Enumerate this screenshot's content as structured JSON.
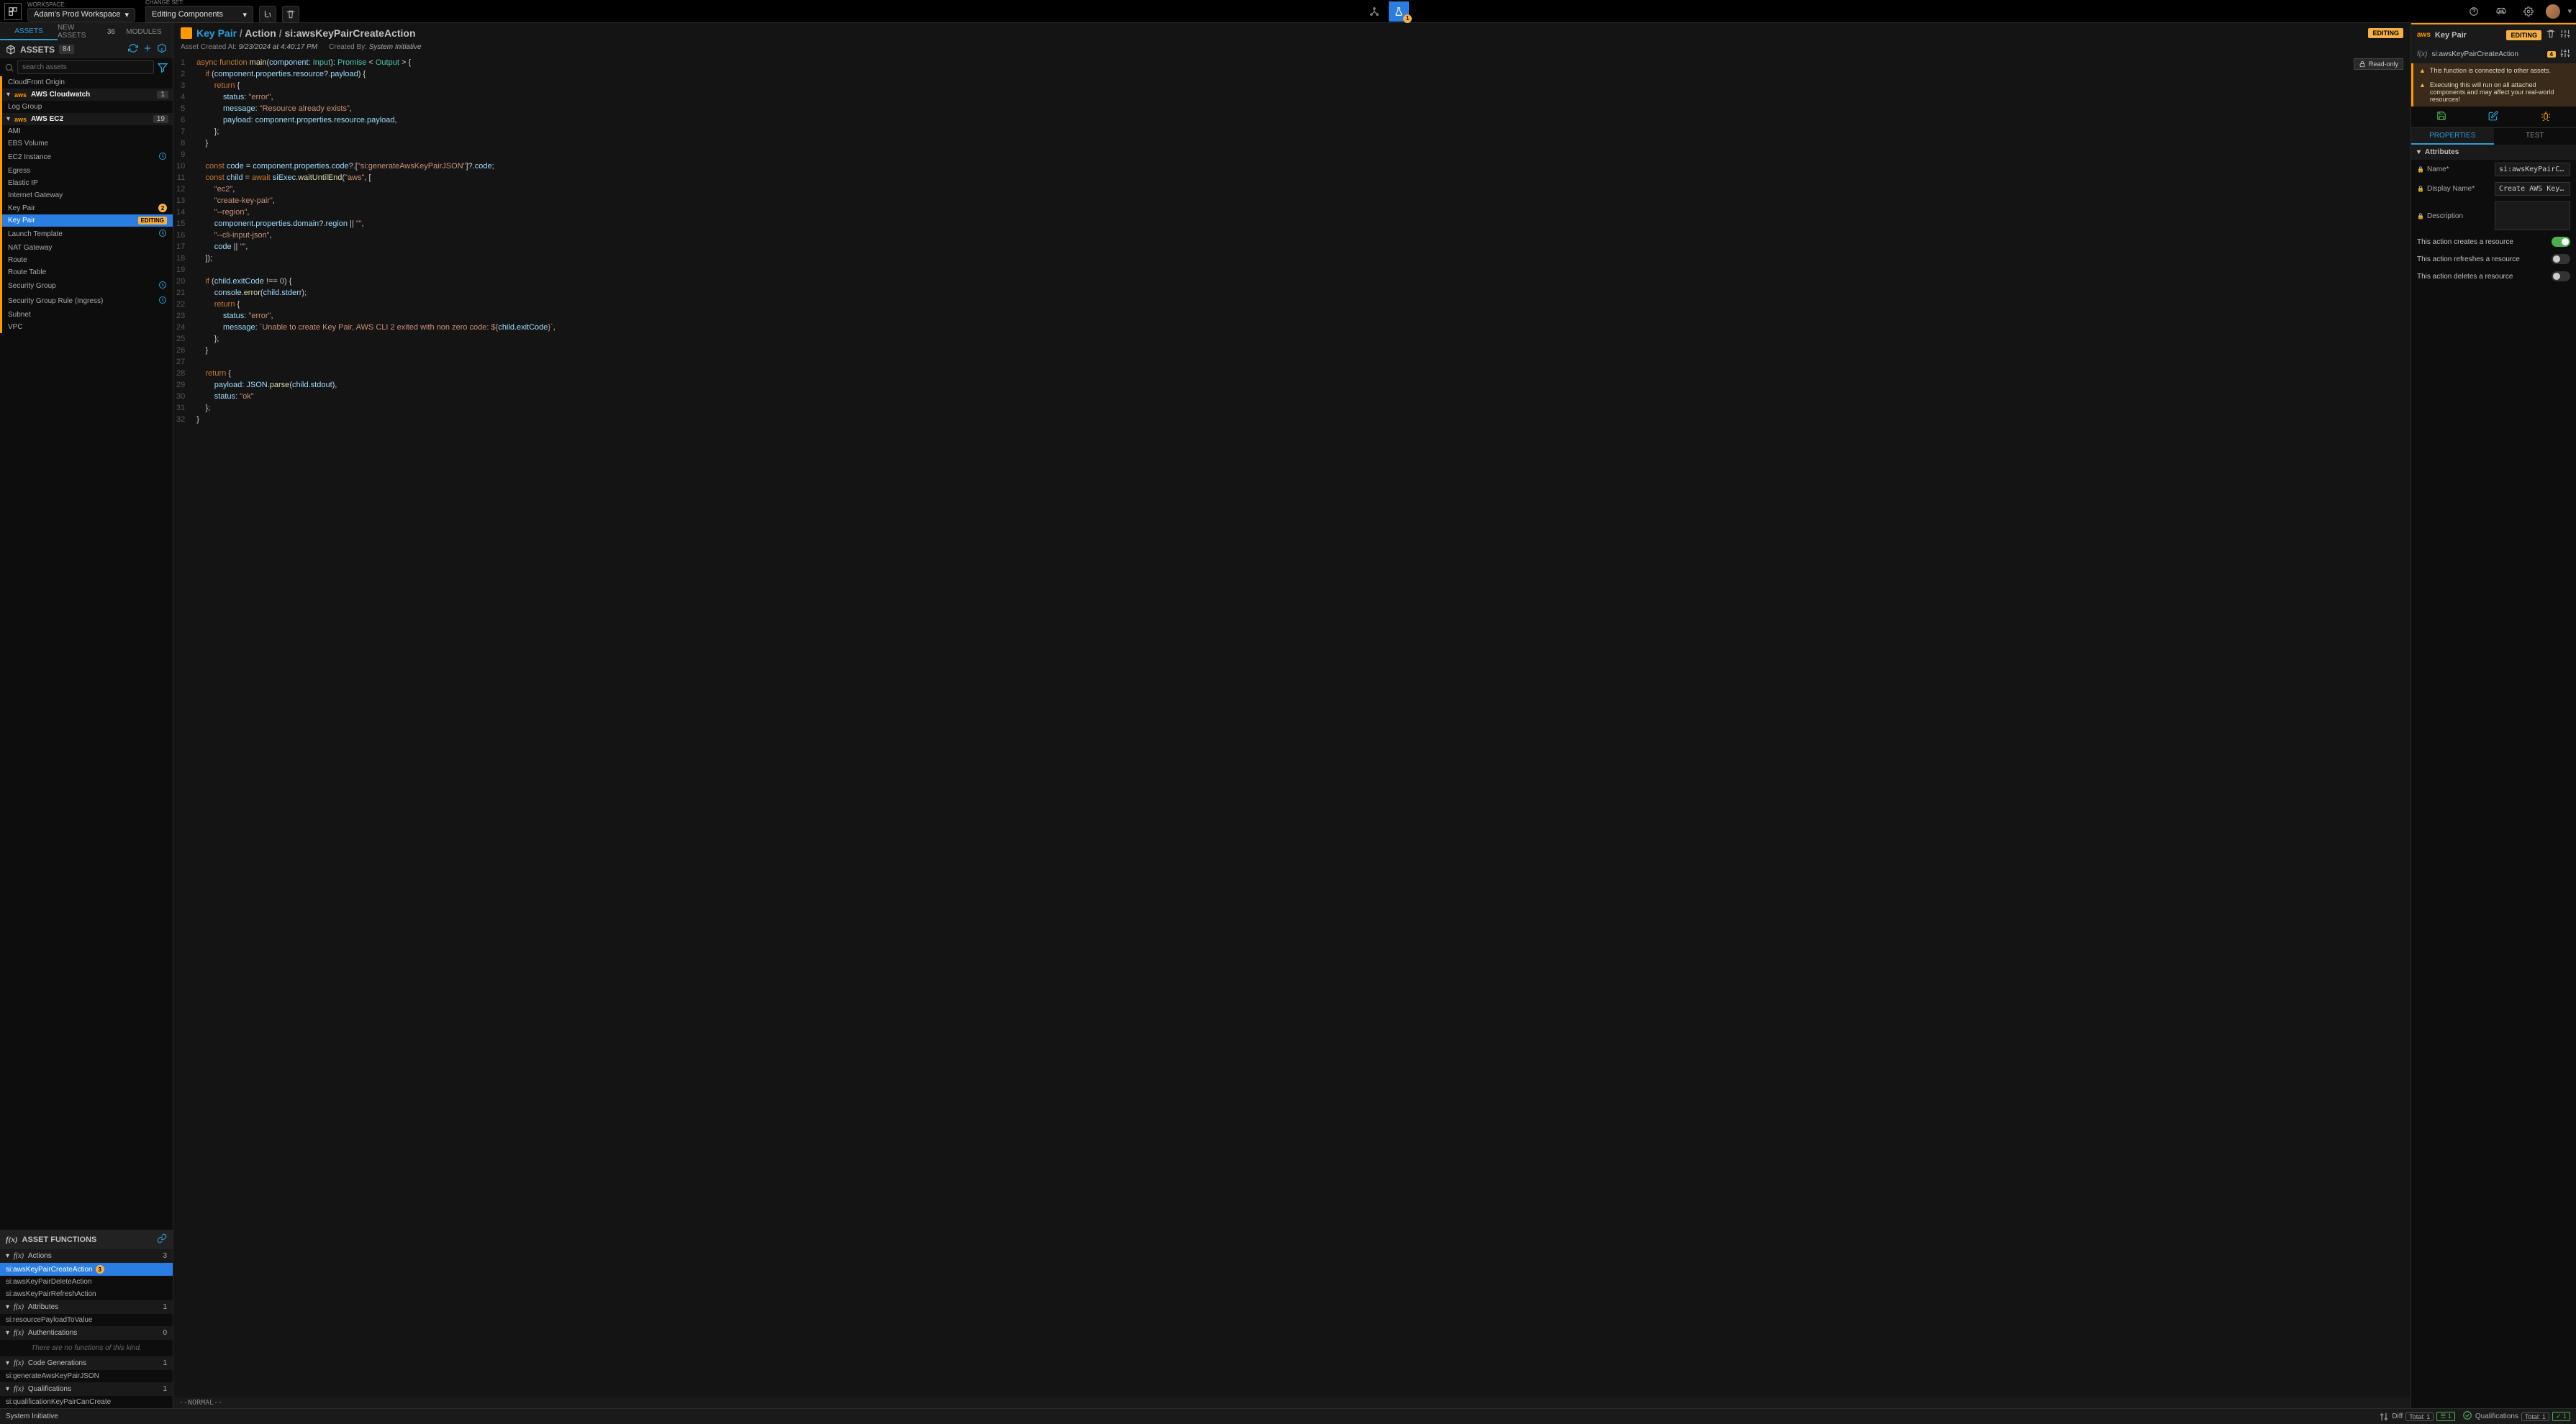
{
  "topbar": {
    "workspace_label": "WORKSPACE:",
    "workspace_value": "Adam's Prod Workspace",
    "changeset_label": "CHANGE SET:",
    "changeset_value": "Editing Components",
    "beaker_badge": "1"
  },
  "left": {
    "tabs": {
      "assets": "ASSETS",
      "new_assets": "NEW ASSETS",
      "new_assets_count": "36",
      "modules": "MODULES"
    },
    "assets_title": "ASSETS",
    "assets_count": "84",
    "search_placeholder": "search assets",
    "groups": [
      {
        "name": "CloudFront Origin",
        "type": "item"
      },
      {
        "name": "AWS Cloudwatch",
        "type": "group",
        "count": "1"
      },
      {
        "name": "Log Group",
        "type": "item"
      },
      {
        "name": "AWS EC2",
        "type": "group",
        "count": "19"
      },
      {
        "name": "AMI",
        "type": "item"
      },
      {
        "name": "EBS Volume",
        "type": "item"
      },
      {
        "name": "EC2 Instance",
        "type": "item",
        "contrib": true
      },
      {
        "name": "Egress",
        "type": "item"
      },
      {
        "name": "Elastic IP",
        "type": "item"
      },
      {
        "name": "Internet Gateway",
        "type": "item"
      },
      {
        "name": "Key Pair",
        "type": "item",
        "badge": "2"
      },
      {
        "name": "Key Pair",
        "type": "item",
        "selected": true,
        "editing": "EDITING"
      },
      {
        "name": "Launch Template",
        "type": "item",
        "contrib": true
      },
      {
        "name": "NAT Gateway",
        "type": "item"
      },
      {
        "name": "Route",
        "type": "item"
      },
      {
        "name": "Route Table",
        "type": "item"
      },
      {
        "name": "Security Group",
        "type": "item",
        "contrib": true
      },
      {
        "name": "Security Group Rule (Ingress)",
        "type": "item",
        "contrib": true
      },
      {
        "name": "Subnet",
        "type": "item"
      },
      {
        "name": "VPC",
        "type": "item"
      }
    ],
    "func_header": "ASSET FUNCTIONS",
    "sections": {
      "actions": {
        "label": "Actions",
        "count": "3",
        "items": [
          {
            "name": "si:awsKeyPairCreateAction",
            "selected": true,
            "badge": "3"
          },
          {
            "name": "si:awsKeyPairDeleteAction"
          },
          {
            "name": "si:awsKeyPairRefreshAction"
          }
        ]
      },
      "attributes": {
        "label": "Attributes",
        "count": "1",
        "items": [
          {
            "name": "si:resourcePayloadToValue"
          }
        ]
      },
      "authentications": {
        "label": "Authentications",
        "count": "0",
        "empty": "There are no functions of this kind."
      },
      "codegen": {
        "label": "Code Generations",
        "count": "1",
        "items": [
          {
            "name": "si:generateAwsKeyPairJSON"
          }
        ]
      },
      "qualifications": {
        "label": "Qualifications",
        "count": "1",
        "items": [
          {
            "name": "si:qualificationKeyPairCanCreate"
          }
        ]
      }
    }
  },
  "editor": {
    "crumb_asset": "Key Pair",
    "crumb_sep1": " / ",
    "crumb_action": "Action",
    "crumb_sep2": " / ",
    "crumb_func": "si:awsKeyPairCreateAction",
    "editing_badge": "EDITING",
    "meta_created_label": "Asset Created At:",
    "meta_created_value": "9/23/2024 at 4:40:17 PM",
    "meta_by_label": "Created By:",
    "meta_by_value": "System Initiative",
    "readonly": "Read-only",
    "status": "--NORMAL--",
    "code_lines": 32
  },
  "right": {
    "title": "Key Pair",
    "editing": "EDITING",
    "func_name": "si:awsKeyPairCreateAction",
    "func_badge": "4",
    "warn1": "This function is connected to other assets.",
    "warn2": "Executing this will run on all attached components and may affect your real-world resources!",
    "tabs": {
      "properties": "PROPERTIES",
      "test": "TEST"
    },
    "attrs_header": "Attributes",
    "attrs": [
      {
        "label": "Name*",
        "value": "si:awsKeyPairCreat…"
      },
      {
        "label": "Display Name*",
        "value": "Create AWS Key Pair"
      },
      {
        "label": "Description",
        "value": ""
      }
    ],
    "toggles": [
      {
        "label": "This action creates a resource",
        "on": true
      },
      {
        "label": "This action refreshes a resource",
        "on": false
      },
      {
        "label": "This action deletes a resource",
        "on": false
      }
    ]
  },
  "bottom": {
    "brand": "System Initiative",
    "diff": "Diff",
    "diff_total": "Total: 1",
    "diff_badge": "1",
    "qual": "Qualifications",
    "qual_total": "Total: 1",
    "qual_badge": "1"
  }
}
